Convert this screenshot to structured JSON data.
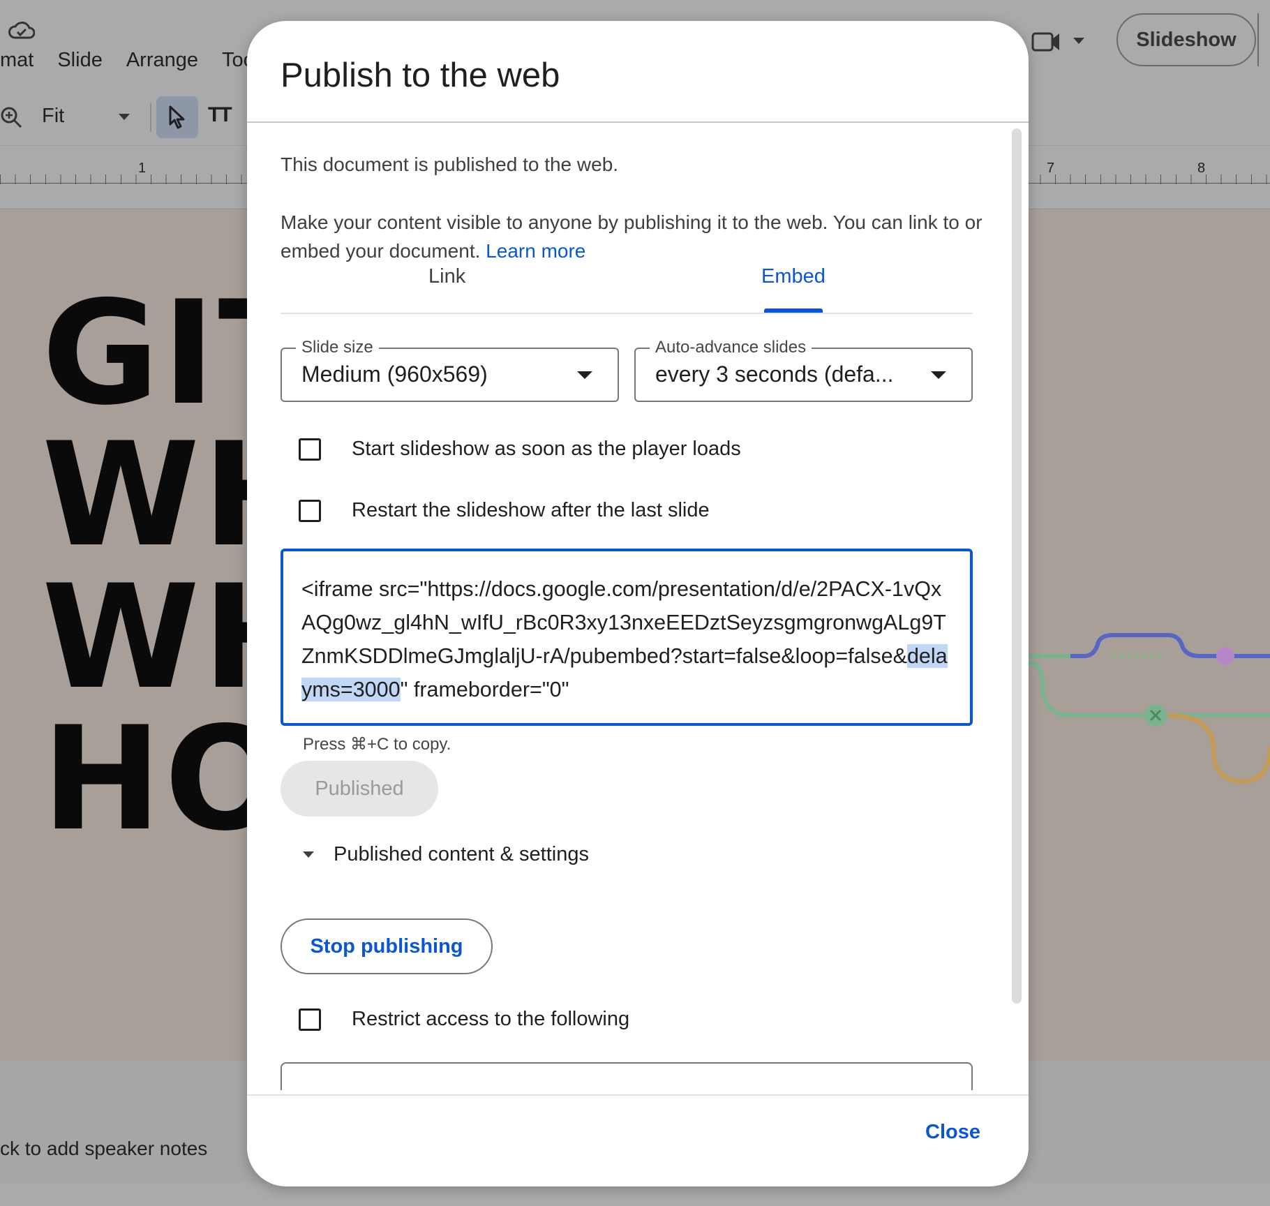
{
  "app": {
    "menu": [
      "mat",
      "Slide",
      "Arrange",
      "Too"
    ],
    "zoom_label": "Fit",
    "text_tool_label": "TT",
    "ruler_numbers": [
      "1",
      "7",
      "8"
    ],
    "slide_lines": [
      "GIT",
      "WH",
      "WH",
      "HO"
    ],
    "slideshow_label": "Slideshow",
    "speaker_notes_placeholder": "ck to add speaker notes"
  },
  "dialog": {
    "title": "Publish to the web",
    "status_text": "This document is published to the web.",
    "description": "Make your content visible to anyone by publishing it to the web. You can link to or embed your document.",
    "learn_more": "Learn more",
    "tabs": [
      {
        "label": "Link",
        "active": false
      },
      {
        "label": "Embed",
        "active": true
      }
    ],
    "slide_size": {
      "label": "Slide size",
      "value": "Medium (960x569)"
    },
    "auto_advance": {
      "label": "Auto-advance slides",
      "value": "every 3 seconds (defa..."
    },
    "checkboxes": {
      "start_on_load": {
        "label": "Start slideshow as soon as the player loads",
        "checked": false
      },
      "restart_after_last": {
        "label": "Restart the slideshow after the last slide",
        "checked": false
      },
      "restrict_access": {
        "label": "Restrict access to the following",
        "checked": false
      }
    },
    "embed_code": {
      "before": "<iframe src=\"https://docs.google.com/presentation/d/e/2PACX-1vQxAQg0wz_gl4hN_wIfU_rBc0R3xy13nxeEEDztSeyzsgmgronwgALg9TZnmKSDDlmeGJmglaljU-rA/pubembed?start=false&loop=false&",
      "highlighted": "delayms=3000",
      "after": "\" frameborder=\"0\""
    },
    "copy_hint": "Press ⌘+C to copy.",
    "published_button": "Published",
    "published_settings_label": "Published content & settings",
    "stop_publishing_button": "Stop publishing",
    "close_button": "Close"
  },
  "colors": {
    "accent": "#0b57d0",
    "selection_highlight": "#c2d7f5",
    "overlay_background": "#a5a5a5"
  }
}
